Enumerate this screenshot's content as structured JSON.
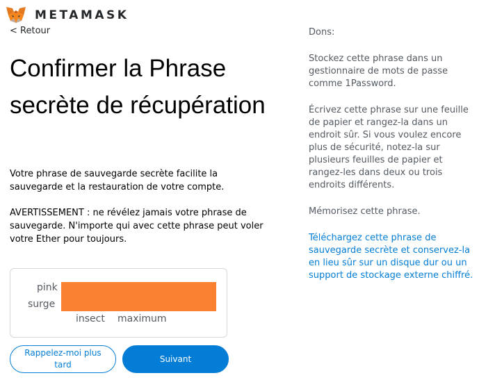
{
  "header": {
    "wordmark": "METAMASK"
  },
  "nav": {
    "back_label": "< Retour"
  },
  "main": {
    "title": "Confirmer la Phrase secrète de récupération",
    "description": "Votre phrase de sauvegarde secrète facilite la sauvegarde et la restauration de votre compte.",
    "warning": "AVERTISSEMENT : ne révélez jamais votre phrase de sauvegarde. N'importe qui avec cette phrase peut voler votre Ether pour toujours.",
    "phrase_words": [
      "pink",
      "surge",
      "insect",
      "maximum"
    ]
  },
  "buttons": {
    "remind_later": "Rappelez-moi plus tard",
    "next": "Suivant"
  },
  "tips": {
    "title": "Dons:",
    "items": [
      "Stockez cette phrase dans un gestionnaire de mots de passe comme 1Password.",
      "Écrivez cette phrase sur une feuille de papier et rangez-la dans un endroit sûr. Si vous voulez encore plus de sécurité, notez-la sur plusieurs feuilles de papier et rangez-les dans deux ou trois endroits différents.",
      "Mémorisez cette phrase."
    ],
    "download_link": "Téléchargez cette phrase de sauvegarde secrète et conservez-la en lieu sûr sur un disque dur ou un support de stockage externe chiffré."
  },
  "colors": {
    "brand_blue": "#037dd6",
    "redaction": "#fb8130",
    "fox_orange": "#e2761b"
  },
  "icons": {
    "logo": "metamask-fox-icon"
  }
}
